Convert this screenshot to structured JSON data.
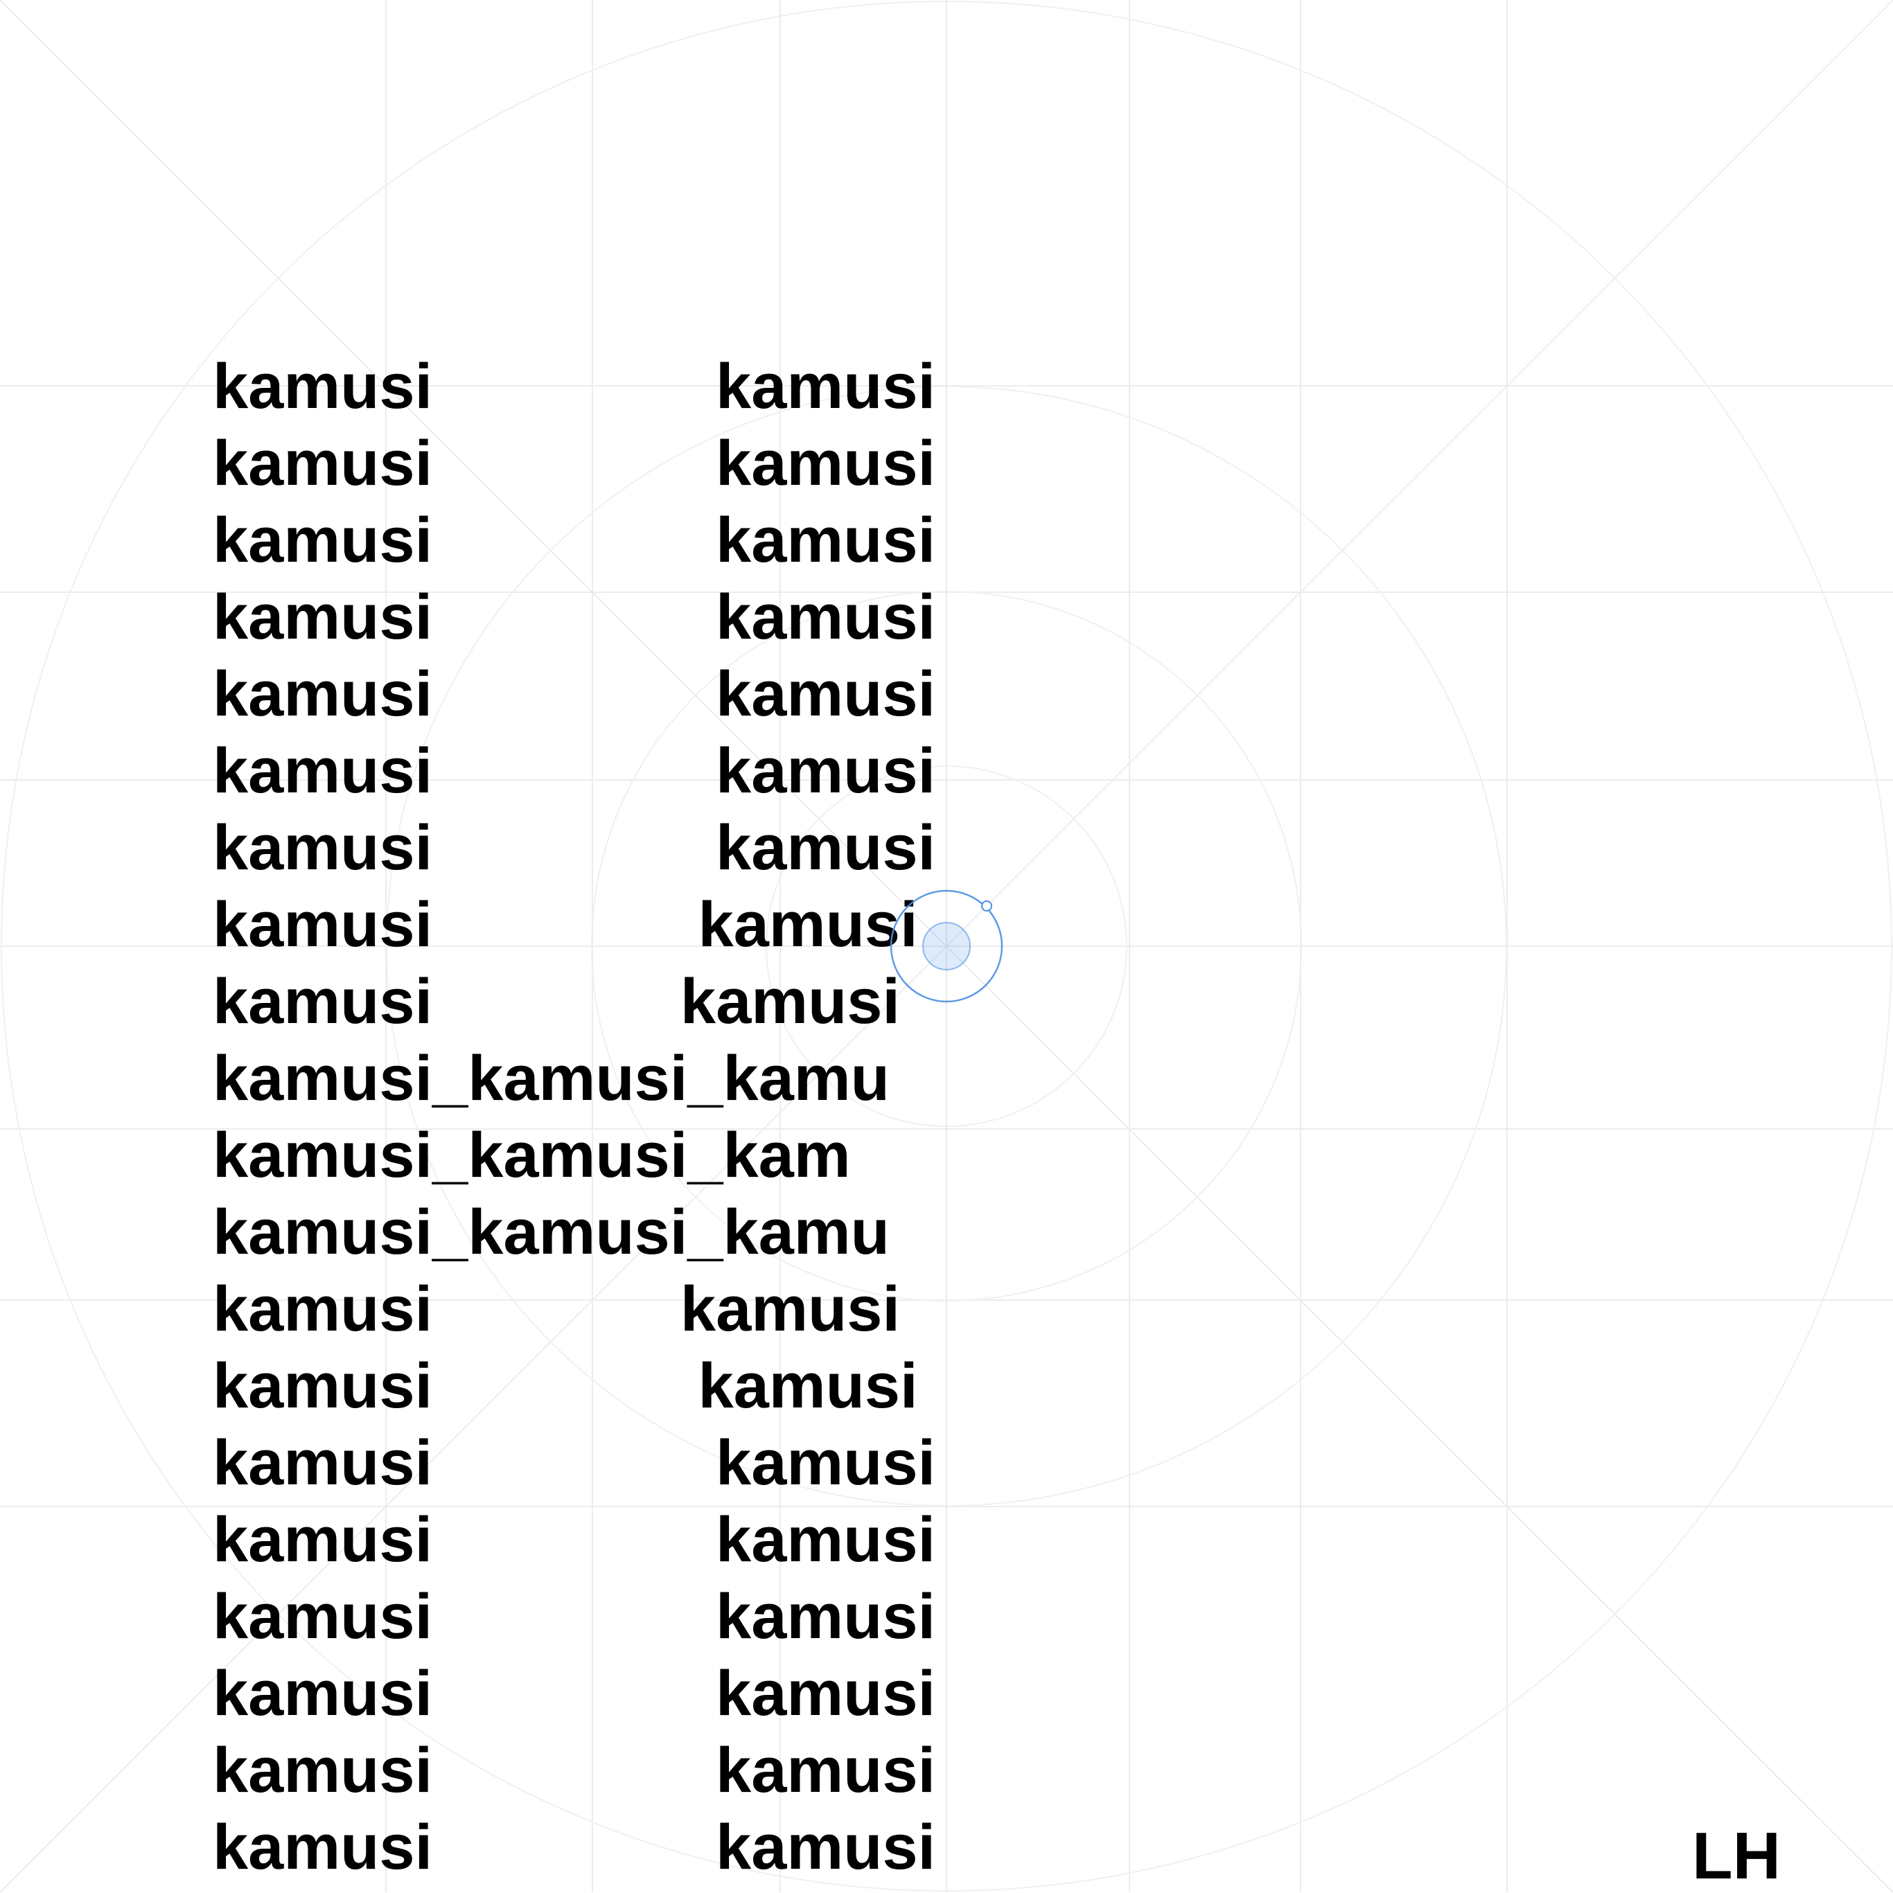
{
  "grid": {
    "visible": true,
    "line_color": "#ececec",
    "circle_color": "#f0f0f0"
  },
  "text_lines": [
    "kamusi                kamusi",
    "kamusi                kamusi",
    "kamusi                kamusi",
    "kamusi                kamusi",
    "kamusi                kamusi",
    "kamusi                kamusi",
    "kamusi                kamusi",
    "kamusi               kamusi",
    "kamusi              kamusi",
    "kamusi_kamusi_kamu",
    "kamusi_kamusi_kam",
    "kamusi_kamusi_kamu",
    "kamusi              kamusi",
    "kamusi               kamusi",
    "kamusi                kamusi",
    "kamusi                kamusi",
    "kamusi                kamusi",
    "kamusi                kamusi",
    "kamusi                kamusi",
    "kamusi                kamusi"
  ],
  "touch_indicator": {
    "icon": "touch-point-icon",
    "color": "#4a90e2"
  },
  "corner_label": "LH"
}
